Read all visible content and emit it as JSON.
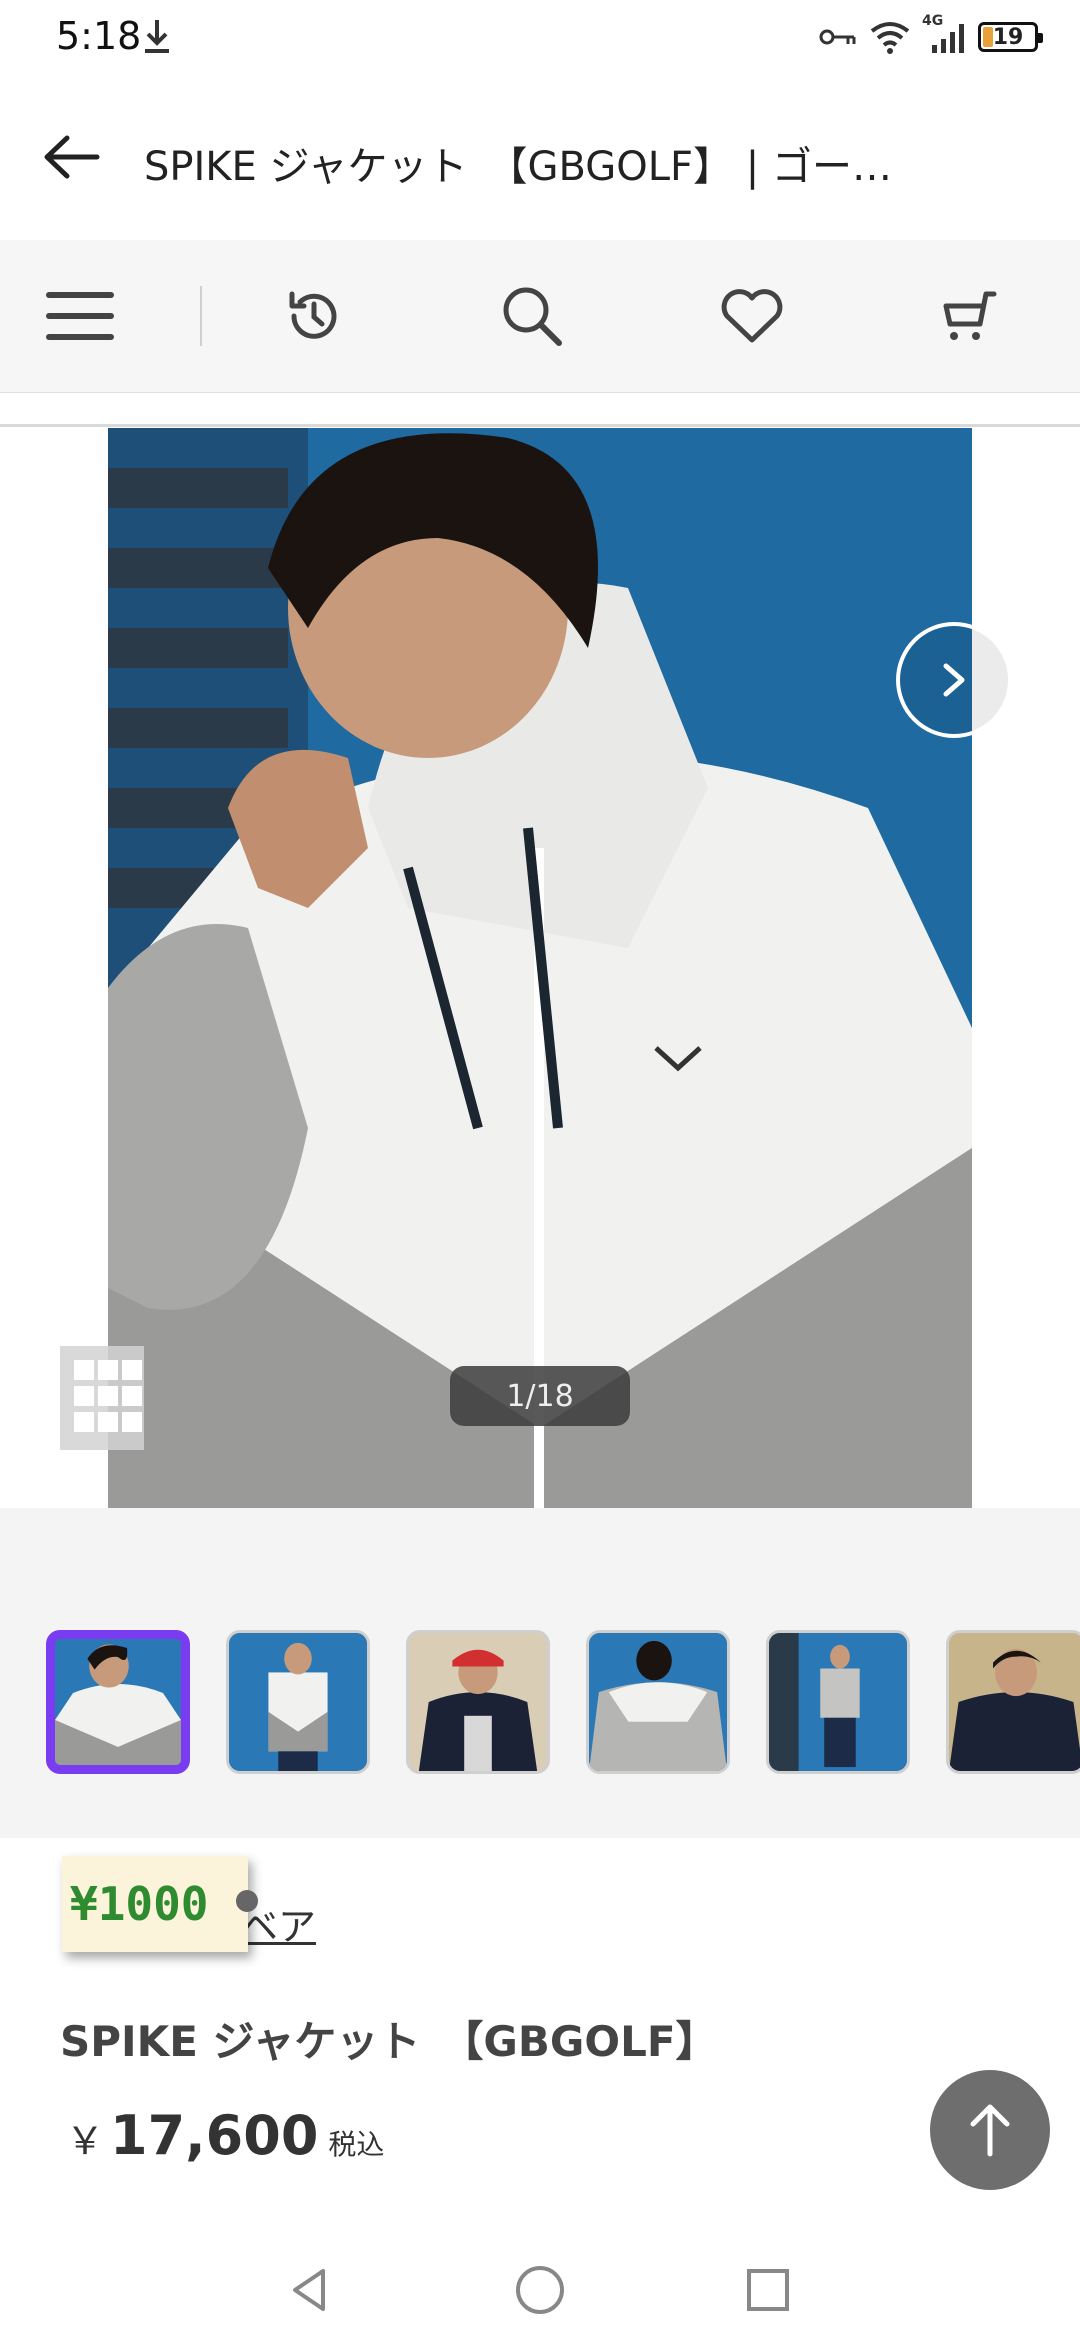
{
  "status_bar": {
    "time": "5:18",
    "network": "4G",
    "battery": "19"
  },
  "app_bar": {
    "title": "SPIKE ジャケット　【GBGOLF】 | ゴー…"
  },
  "gallery": {
    "counter": "1/18",
    "current_index": 1,
    "total": 18,
    "thumbnail_count": 6
  },
  "coupon": {
    "label": "¥1000"
  },
  "product": {
    "brand_link_visible": "ベア",
    "name": "SPIKE ジャケット　【GBGOLF】",
    "currency": "￥",
    "price": "17,600",
    "tax_label": "税込"
  },
  "colors": {
    "accent": "#7a3cf0",
    "coupon_text": "#2e8b30",
    "coupon_bg": "#fbf4da",
    "fab": "#6e6e6e"
  }
}
